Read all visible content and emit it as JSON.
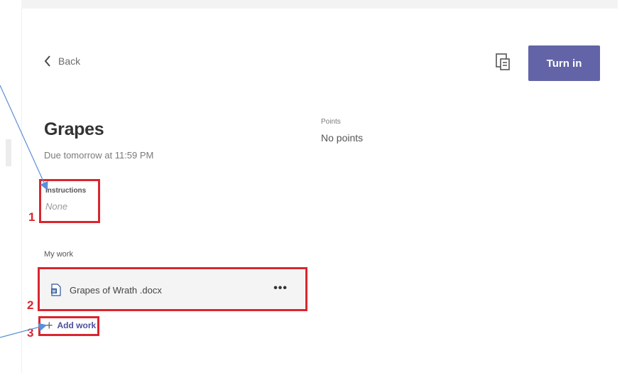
{
  "header": {
    "back_label": "Back",
    "turn_in_label": "Turn in",
    "icon": "immersive-reader-icon"
  },
  "assignment": {
    "title": "Grapes",
    "due": "Due tomorrow at 11:59 PM",
    "points_label": "Points",
    "points_value": "No points",
    "instructions_label": "Instructions",
    "instructions_value": "None"
  },
  "my_work": {
    "label": "My work",
    "files": [
      {
        "name": "Grapes of Wrath .docx",
        "icon": "word-doc-icon",
        "more_label": "•••"
      }
    ],
    "add_work_label": "Add work"
  },
  "annotations": {
    "labels": [
      "1",
      "2",
      "3"
    ],
    "color": "#d9262e"
  },
  "colors": {
    "accent": "#6264a7",
    "link": "#4b4f9e",
    "annotation": "#d9262e",
    "arrow": "#5b8fd6"
  }
}
